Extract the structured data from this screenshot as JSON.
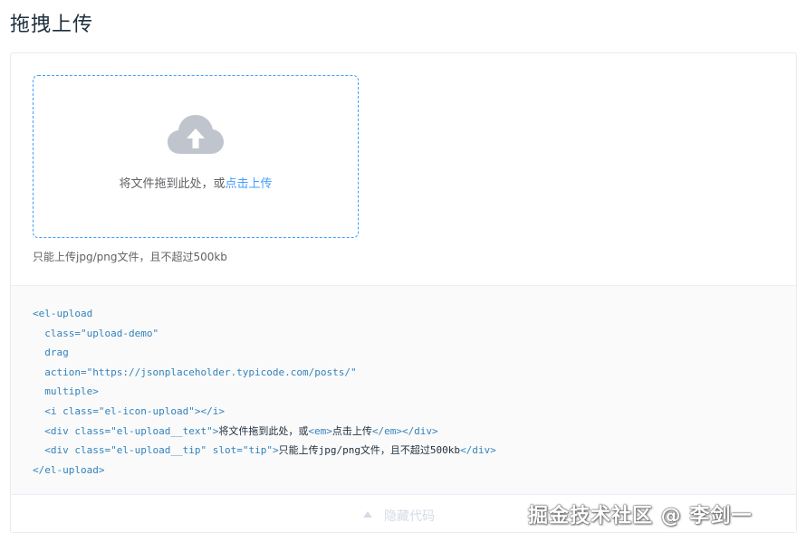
{
  "page": {
    "title": "拖拽上传"
  },
  "upload": {
    "text_prefix": "将文件拖到此处，或",
    "text_link": "点击上传",
    "tip": "只能上传jpg/png文件，且不超过500kb",
    "icon": "upload-cloud-icon",
    "accent_color": "#409eff",
    "icon_color": "#c0c4cc"
  },
  "code": {
    "lines": [
      [
        {
          "c": "tag",
          "t": "<el-upload"
        }
      ],
      [
        {
          "c": "attr",
          "t": "  class="
        },
        {
          "c": "str",
          "t": "\"upload-demo\""
        }
      ],
      [
        {
          "c": "attr",
          "t": "  drag"
        }
      ],
      [
        {
          "c": "attr",
          "t": "  action="
        },
        {
          "c": "str",
          "t": "\"https://jsonplaceholder.typicode.com/posts/\""
        }
      ],
      [
        {
          "c": "attr",
          "t": "  multiple"
        },
        {
          "c": "tag",
          "t": ">"
        }
      ],
      [
        {
          "c": "tag",
          "t": "  <i "
        },
        {
          "c": "attr",
          "t": "class="
        },
        {
          "c": "str",
          "t": "\"el-icon-upload\""
        },
        {
          "c": "tag",
          "t": "></i>"
        }
      ],
      [
        {
          "c": "tag",
          "t": "  <div "
        },
        {
          "c": "attr",
          "t": "class="
        },
        {
          "c": "str",
          "t": "\"el-upload__text\""
        },
        {
          "c": "tag",
          "t": ">"
        },
        {
          "c": "txt",
          "t": "将文件拖到此处，或"
        },
        {
          "c": "tag",
          "t": "<em>"
        },
        {
          "c": "txt",
          "t": "点击上传"
        },
        {
          "c": "tag",
          "t": "</em></div>"
        }
      ],
      [
        {
          "c": "tag",
          "t": "  <div "
        },
        {
          "c": "attr",
          "t": "class="
        },
        {
          "c": "str",
          "t": "\"el-upload__tip\""
        },
        {
          "c": "attr",
          "t": " slot="
        },
        {
          "c": "str",
          "t": "\"tip\""
        },
        {
          "c": "tag",
          "t": ">"
        },
        {
          "c": "txt",
          "t": "只能上传jpg/png文件，且不超过500kb"
        },
        {
          "c": "tag",
          "t": "</div>"
        }
      ],
      [
        {
          "c": "tag",
          "t": "</el-upload>"
        }
      ]
    ]
  },
  "control": {
    "label": "隐藏代码",
    "icon": "caret-up-icon"
  },
  "watermark": {
    "text": "掘金技术社区 @ 李剑一"
  }
}
